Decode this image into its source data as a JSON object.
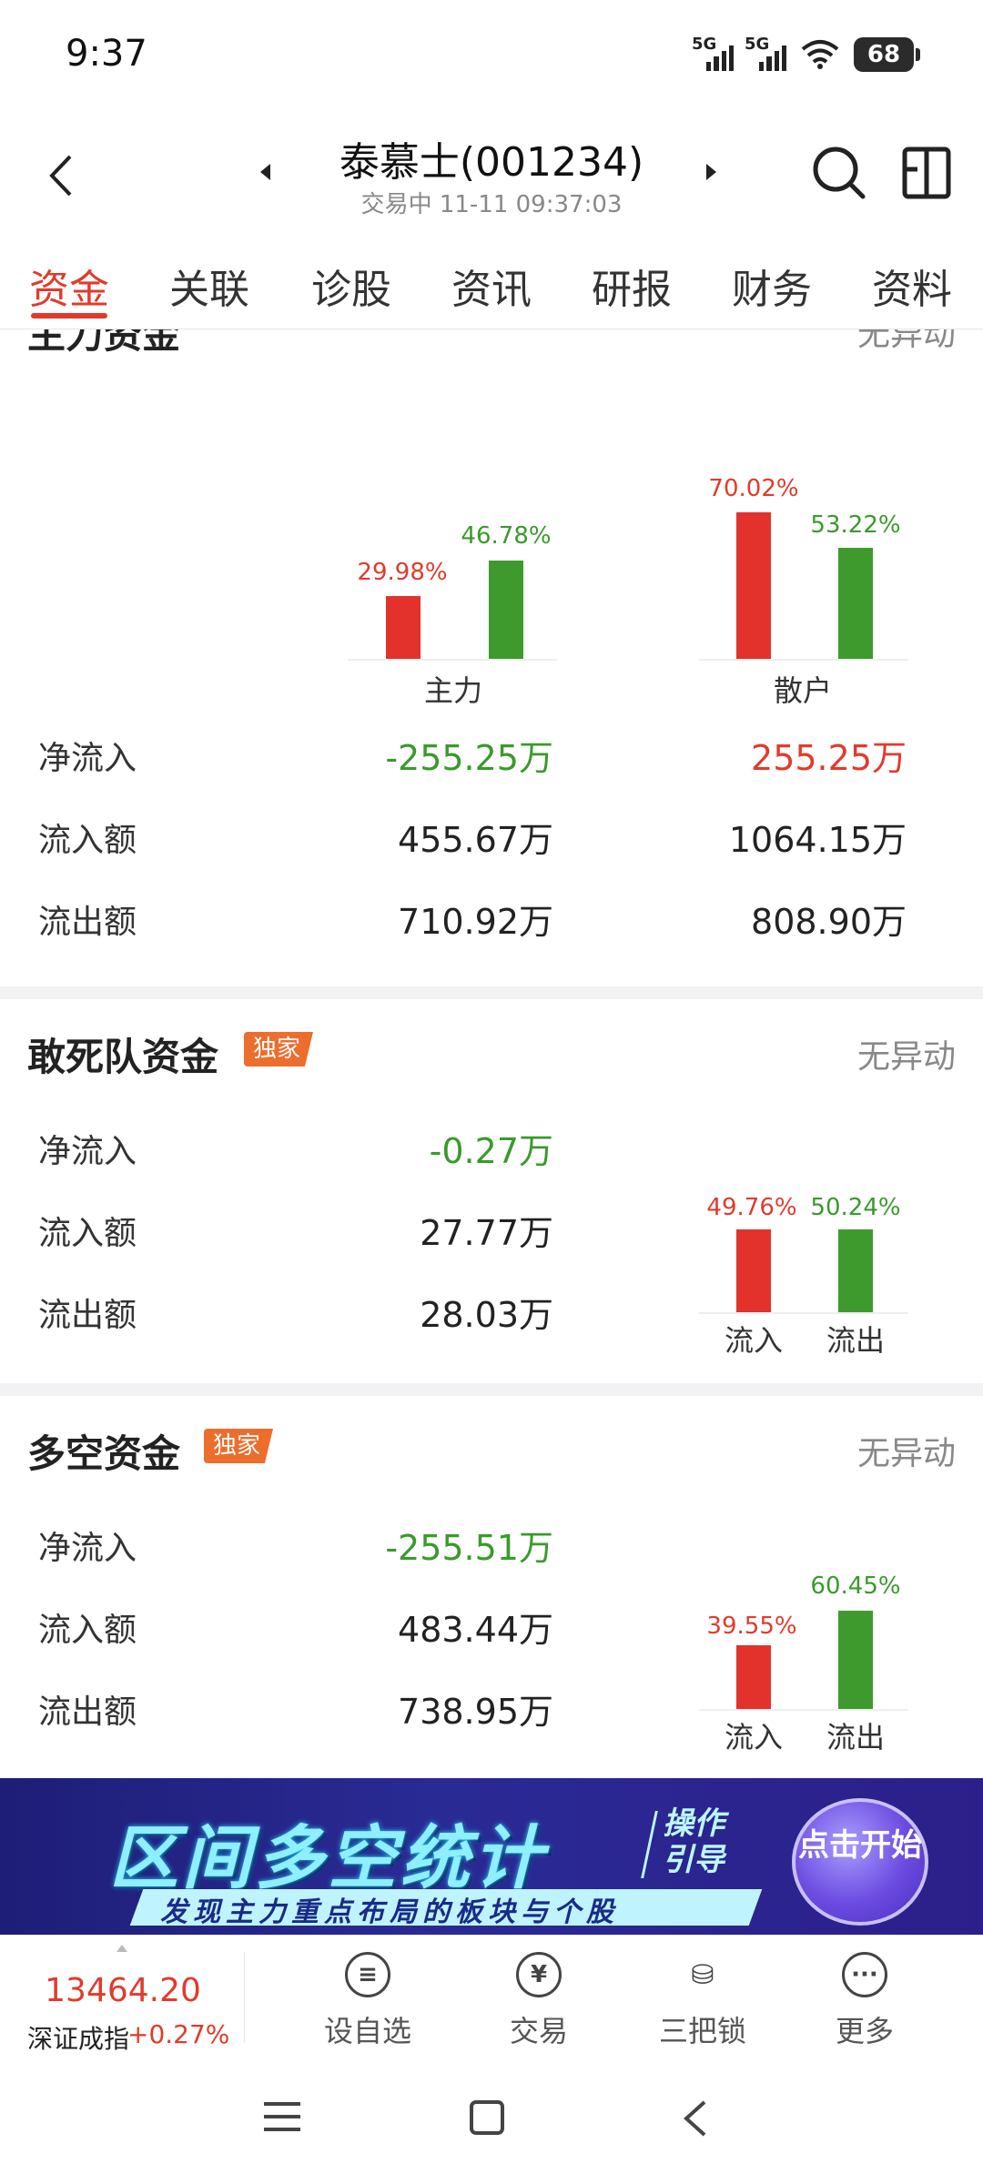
{
  "status_bar": {
    "time": "9:37",
    "signal1": "5G",
    "signal2": "5G",
    "battery": "68"
  },
  "header": {
    "title": "泰慕士(001234)",
    "subtitle": "交易中 11-11 09:37:03"
  },
  "tabs": [
    "资金",
    "关联",
    "诊股",
    "资讯",
    "研报",
    "财务",
    "资料"
  ],
  "main_funds": {
    "title": "主力资金",
    "status": "无异动",
    "groups": [
      {
        "label": "主力",
        "in_pct": "29.98%",
        "out_pct": "46.78%",
        "in_value": 29.98,
        "out_value": 46.78
      },
      {
        "label": "散户",
        "in_pct": "70.02%",
        "out_pct": "53.22%",
        "in_value": 70.02,
        "out_value": 53.22
      }
    ],
    "rows": [
      {
        "label": "净流入",
        "main": "-255.25万",
        "retail": "255.25万"
      },
      {
        "label": "流入额",
        "main": "455.67万",
        "retail": "1064.15万"
      },
      {
        "label": "流出额",
        "main": "710.92万",
        "retail": "808.90万"
      }
    ]
  },
  "dare_funds": {
    "title": "敢死队资金",
    "badge": "独家",
    "status": "无异动",
    "rows": [
      {
        "label": "净流入",
        "value": "-0.27万"
      },
      {
        "label": "流入额",
        "value": "27.77万"
      },
      {
        "label": "流出额",
        "value": "28.03万"
      }
    ],
    "chart": {
      "in_label": "流入",
      "out_label": "流出",
      "in_pct": "49.76%",
      "out_pct": "50.24%",
      "in_value": 49.76,
      "out_value": 50.24
    }
  },
  "longshort_funds": {
    "title": "多空资金",
    "badge": "独家",
    "status": "无异动",
    "rows": [
      {
        "label": "净流入",
        "value": "-255.51万"
      },
      {
        "label": "流入额",
        "value": "483.44万"
      },
      {
        "label": "流出额",
        "value": "738.95万"
      }
    ],
    "chart": {
      "in_label": "流入",
      "out_label": "流出",
      "in_pct": "39.55%",
      "out_pct": "60.45%",
      "in_value": 39.55,
      "out_value": 60.45
    }
  },
  "banner": {
    "main": "区间多空统计",
    "guide": "操作引导",
    "sub": "发现主力重点布局的板块与个股",
    "button": "点击开始"
  },
  "bottom_bar": {
    "index_value": "13464.20",
    "index_name": "深证成指",
    "index_change": "+0.27%",
    "items": [
      {
        "label": "设自选",
        "icon": "list-icon"
      },
      {
        "label": "交易",
        "icon": "yuan-icon"
      },
      {
        "label": "三把锁",
        "icon": "locks-icon"
      },
      {
        "label": "更多",
        "icon": "more-icon"
      }
    ]
  },
  "colors": {
    "accent": "#e13b2c",
    "up": "#e2322b",
    "down": "#3f9a2e"
  }
}
